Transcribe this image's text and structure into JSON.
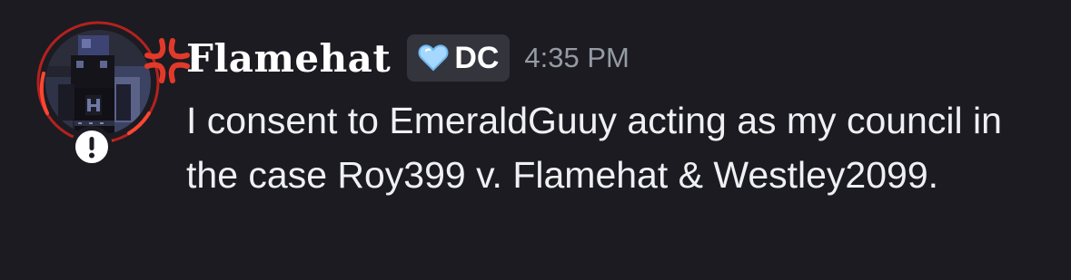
{
  "message": {
    "author": {
      "username": "Flamehat",
      "tag": {
        "icon": "blue-heart-icon",
        "label": "DC",
        "icon_color": "#a6d8ff"
      },
      "avatar": {
        "decoration": "angry-anger-symbol-icon",
        "status_badge": "exclamation-icon",
        "ring_color": "#b3221f"
      }
    },
    "timestamp": "4:35 PM",
    "content": "I consent to EmeraldGuuy acting as my council in the case Roy399 v. Flamehat & Westley2099."
  },
  "theme": {
    "background": "#1c1b21",
    "text_primary": "#ffffff",
    "text_muted": "#949ba4",
    "tag_background": "#34343c",
    "accent_red": "#e23a2a"
  }
}
